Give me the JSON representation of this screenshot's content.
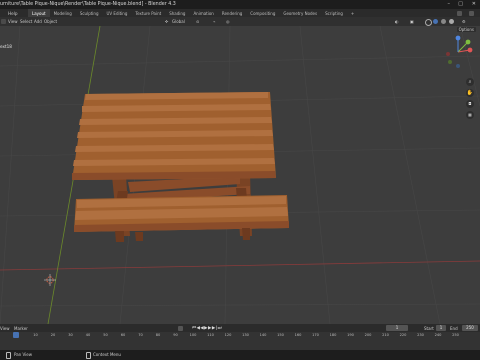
{
  "window": {
    "title": "urniture\\Table Pique-Nique\\Render\\Table Pique-Nique.blend] - Blender 4.3"
  },
  "menu": {
    "items": [
      "File",
      "Edit",
      "Render",
      "Window",
      "Help"
    ],
    "workspaces": [
      "Layout",
      "Modeling",
      "Sculpting",
      "UV Editing",
      "Texture Paint",
      "Shading",
      "Animation",
      "Rendering",
      "Compositing",
      "Geometry Nodes",
      "Scripting"
    ],
    "add_workspace": "+"
  },
  "header": {
    "menus": [
      "View",
      "Select",
      "Add",
      "Object"
    ],
    "orientation": "Global",
    "options": "Options"
  },
  "viewport": {
    "object_label": "ext18"
  },
  "timeline": {
    "menus": [
      "View",
      "Marker"
    ],
    "current_frame": "1",
    "start_label": "Start",
    "start_value": "1",
    "end_label": "End",
    "end_value": "250",
    "ticks": [
      "0",
      "10",
      "20",
      "30",
      "40",
      "50",
      "60",
      "70",
      "80",
      "90",
      "100",
      "110",
      "120",
      "130",
      "140",
      "150",
      "160",
      "170",
      "180",
      "190",
      "200",
      "210",
      "220",
      "230",
      "240",
      "250"
    ]
  },
  "status": {
    "left": "Pan View",
    "mid": "Context Menu"
  },
  "colors": {
    "accent": "#4772b3",
    "wood": "#9a5a33",
    "grid_x": "#8a3b3b",
    "grid_y": "#6b8a2a"
  }
}
